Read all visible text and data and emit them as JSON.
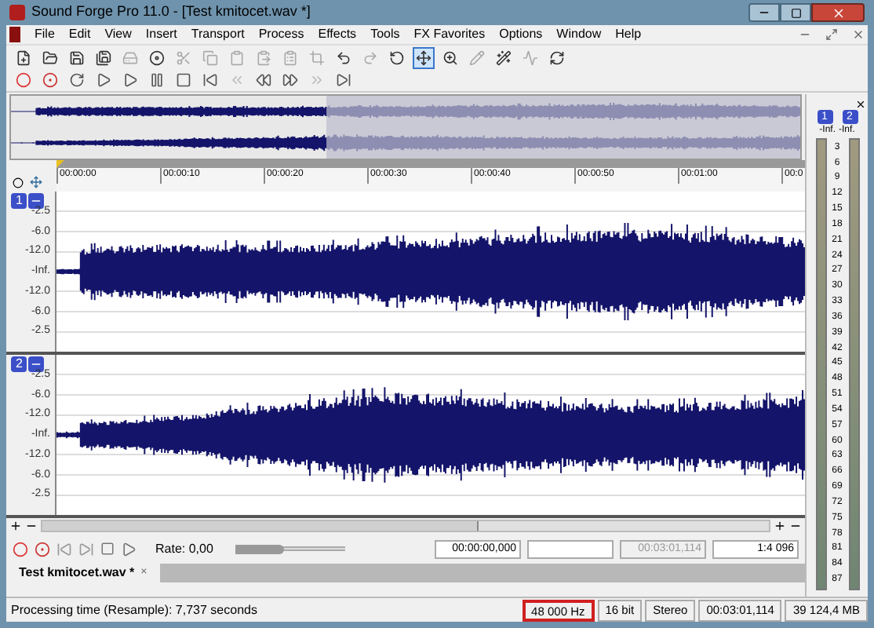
{
  "window": {
    "title": "Sound Forge Pro 11.0 - [Test kmitocet.wav *]"
  },
  "menu": [
    "File",
    "Edit",
    "View",
    "Insert",
    "Transport",
    "Process",
    "Effects",
    "Tools",
    "FX Favorites",
    "Options",
    "Window",
    "Help"
  ],
  "toolbar_main": [
    {
      "disabled": false,
      "selected": false
    },
    {
      "disabled": false,
      "selected": false
    },
    {
      "disabled": false,
      "selected": false
    },
    {
      "disabled": false,
      "selected": false
    },
    {
      "disabled": true,
      "selected": false
    },
    {
      "disabled": false,
      "selected": false
    },
    {
      "disabled": true,
      "selected": false
    },
    {
      "disabled": true,
      "selected": false
    },
    {
      "disabled": true,
      "selected": false
    },
    {
      "disabled": true,
      "selected": false
    },
    {
      "disabled": true,
      "selected": false
    },
    {
      "disabled": true,
      "selected": false
    },
    {
      "disabled": false,
      "selected": false
    },
    {
      "disabled": true,
      "selected": false
    },
    {
      "disabled": false,
      "selected": false
    },
    {
      "disabled": false,
      "selected": true
    },
    {
      "disabled": false,
      "selected": false
    },
    {
      "disabled": true,
      "selected": false
    },
    {
      "disabled": false,
      "selected": false
    },
    {
      "disabled": true,
      "selected": false
    },
    {
      "disabled": false,
      "selected": false
    }
  ],
  "toolbar_transport": [
    {
      "disabled": false
    },
    {
      "disabled": false
    },
    {
      "disabled": false
    },
    {
      "disabled": false
    },
    {
      "disabled": false
    },
    {
      "disabled": false
    },
    {
      "disabled": false
    },
    {
      "disabled": false
    },
    {
      "disabled": true
    },
    {
      "disabled": false
    },
    {
      "disabled": false
    },
    {
      "disabled": true
    },
    {
      "disabled": false
    }
  ],
  "ruler": {
    "times": [
      "00:00:00",
      "00:00:10",
      "00:00:20",
      "00:00:30",
      "00:00:40",
      "00:00:50",
      "00:01:00",
      "00:0"
    ]
  },
  "channels": [
    {
      "number": "1",
      "scale": [
        "-2.5",
        "-6.0",
        "-12.0",
        "-Inf.",
        "-12.0",
        "-6.0",
        "-2.5"
      ]
    },
    {
      "number": "2",
      "scale": [
        "-2.5",
        "-6.0",
        "-12.0",
        "-Inf.",
        "-12.0",
        "-6.0",
        "-2.5"
      ]
    }
  ],
  "transport": {
    "rate": "Rate: 0,00",
    "rate_slider": {
      "level": 0.45
    },
    "fields": [
      {
        "value": "00:00:00,000",
        "disabled": false
      },
      {
        "disabled": false
      },
      {
        "value": "00:03:01,114",
        "disabled": true
      },
      {
        "value": "1:4 096",
        "disabled": false
      }
    ]
  },
  "tabs": [
    {
      "label": "Test kmitocet.wav *",
      "selected": true,
      "close": "×"
    }
  ],
  "meters": {
    "channels": [
      {
        "number": "1",
        "reading": "-Inf."
      },
      {
        "number": "2",
        "reading": "-Inf."
      }
    ],
    "scale": [
      "3",
      "6",
      "9",
      "12",
      "15",
      "18",
      "21",
      "24",
      "27",
      "30",
      "33",
      "36",
      "39",
      "42",
      "45",
      "48",
      "51",
      "54",
      "57",
      "60",
      "63",
      "66",
      "69",
      "72",
      "75",
      "78",
      "81",
      "84",
      "87"
    ]
  },
  "status_bar": {
    "message": "Processing time (Resample): 7,737 seconds",
    "cells": [
      {
        "text": "48 000 Hz",
        "highlighted": true
      },
      {
        "text": "16 bit",
        "highlighted": false
      },
      {
        "text": "Stereo",
        "highlighted": false
      },
      {
        "text": "00:03:01,114",
        "highlighted": false
      },
      {
        "text": "39 124,4 MB",
        "highlighted": false
      }
    ]
  }
}
